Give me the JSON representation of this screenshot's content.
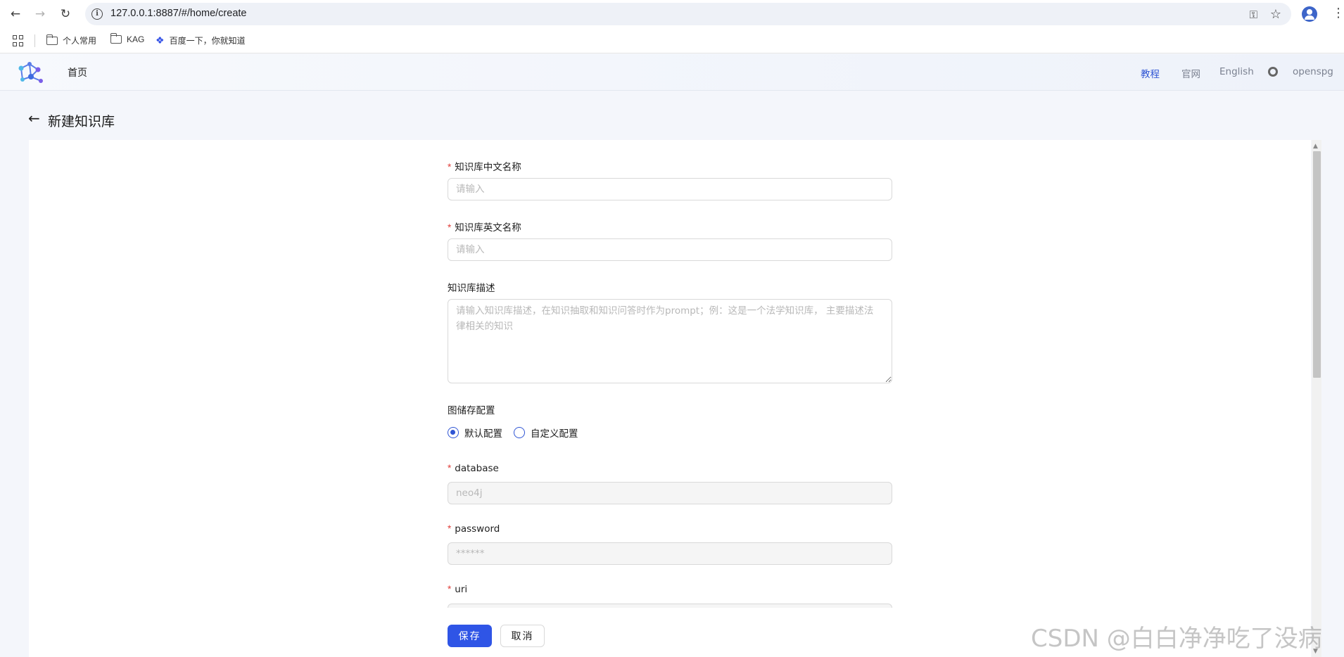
{
  "browser": {
    "url": "127.0.0.1:8887/#/home/create",
    "bookmarks": [
      "个人常用",
      "KAG",
      "百度一下，你就知道"
    ]
  },
  "header": {
    "home": "首页",
    "links": [
      "教程",
      "官网",
      "English",
      "openspg"
    ],
    "active_link": "教程"
  },
  "page": {
    "title": "新建知识库"
  },
  "form": {
    "cn_name": {
      "label": "知识库中文名称",
      "placeholder": "请输入"
    },
    "en_name": {
      "label": "知识库英文名称",
      "placeholder": "请输入"
    },
    "description": {
      "label": "知识库描述",
      "placeholder": "请输入知识库描述，在知识抽取和知识问答时作为prompt；例：这是一个法学知识库， 主要描述法 律相关的知识"
    },
    "graph_store": {
      "label": "图储存配置",
      "options": [
        "默认配置",
        "自定义配置"
      ],
      "selected": "默认配置"
    },
    "database": {
      "label": "database",
      "placeholder": "neo4j"
    },
    "password": {
      "label": "password",
      "placeholder": "******"
    },
    "uri": {
      "label": "uri"
    },
    "required_mark": "*"
  },
  "buttons": {
    "save": "保存",
    "cancel": "取消"
  },
  "watermark": "CSDN @白白净净吃了没病",
  "colors": {
    "primary": "#2f55e6",
    "required": "#e0403c",
    "active_link": "#2f55d4"
  }
}
